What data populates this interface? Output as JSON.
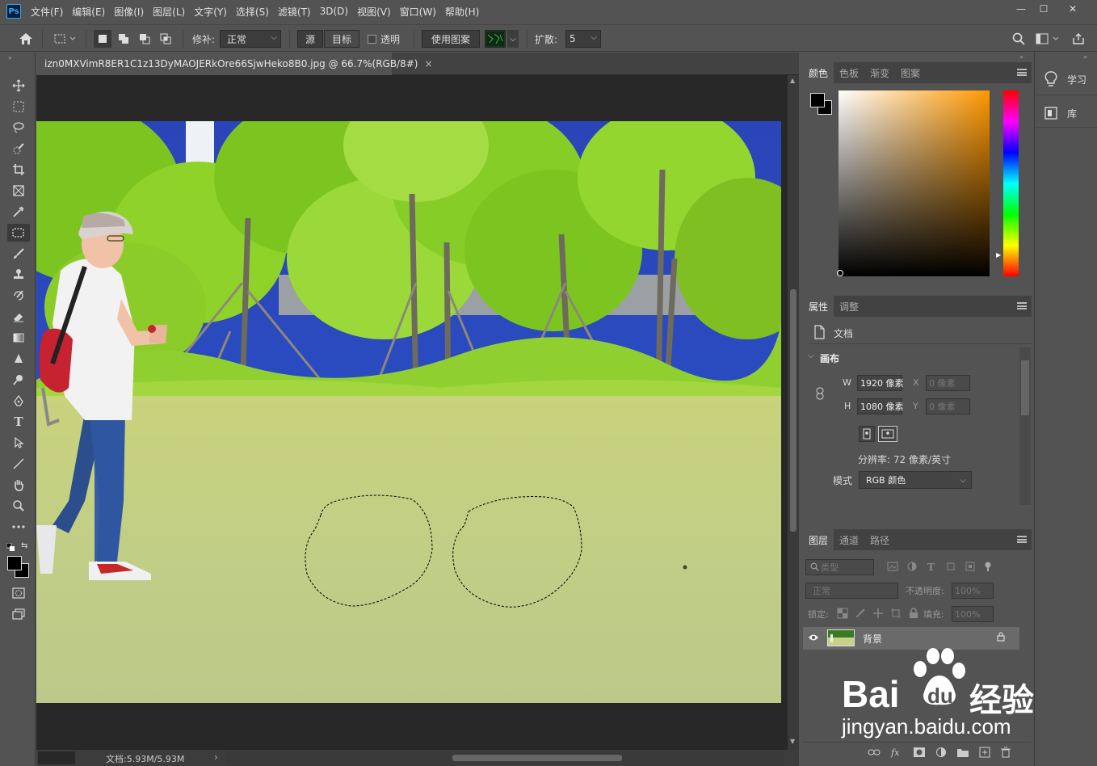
{
  "app": {
    "logo": "Ps"
  },
  "menu": [
    "文件(F)",
    "编辑(E)",
    "图像(I)",
    "图层(L)",
    "文字(Y)",
    "选择(S)",
    "滤镜(T)",
    "3D(D)",
    "视图(V)",
    "窗口(W)",
    "帮助(H)"
  ],
  "window_controls": {
    "minimize": "—",
    "maximize": "☐",
    "close": "✕"
  },
  "options": {
    "patch_label": "修补:",
    "patch_mode": "正常",
    "source_label": "源",
    "target_label": "目标",
    "transparent_label": "透明",
    "use_pattern_label": "使用图案",
    "diffusion_label": "扩散:",
    "diffusion_value": "5"
  },
  "document": {
    "tab_title": "izn0MXVimR8ER1C1z13DyMAOJERkOre66SjwHeko8B0.jpg @ 66.7%(RGB/8#)",
    "close": "×",
    "status": "文档:5.93M/5.93M",
    "status_arrow": "›"
  },
  "color_panel": {
    "tabs": [
      "颜色",
      "色板",
      "渐变",
      "图案"
    ],
    "active": 0
  },
  "properties_panel": {
    "tabs": [
      "属性",
      "调整"
    ],
    "doc_label": "文档",
    "canvas_section": "画布",
    "w_label": "W",
    "w_value": "1920 像素",
    "h_label": "H",
    "h_value": "1080 像素",
    "x_label": "X",
    "x_value": "0 像素",
    "y_label": "Y",
    "y_value": "0 像素",
    "resolution": "分辨率: 72 像素/英寸",
    "mode_label": "模式",
    "mode_value": "RGB 颜色"
  },
  "layers_panel": {
    "tabs": [
      "图层",
      "通道",
      "路径"
    ],
    "filter_kind": "类型",
    "blend_mode": "正常",
    "opacity_label": "不透明度:",
    "opacity_value": "100%",
    "lock_label": "锁定:",
    "fill_label": "填充:",
    "fill_value": "100%",
    "layers": [
      {
        "name": "背景",
        "locked": true,
        "visible": true
      }
    ]
  },
  "side_panel": {
    "learn": "学习",
    "library": "库"
  },
  "watermark": {
    "brand": "Bai",
    "du": "du",
    "product": "经验",
    "url": "jingyan.baidu.com"
  },
  "colors": {
    "accent": "#31a8ff",
    "bg": "#535353",
    "dark": "#282828"
  }
}
